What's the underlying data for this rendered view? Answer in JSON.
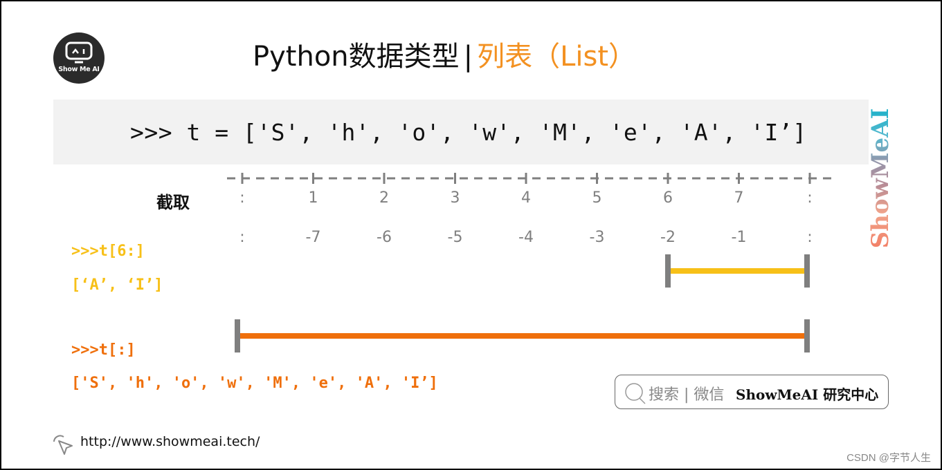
{
  "header": {
    "logo_text": "Show Me AI",
    "title_main": "Python数据类型",
    "title_separator": "|",
    "title_highlight": "列表（List）"
  },
  "code": {
    "definition": ">>> t = ['S', 'h', 'o', 'w', 'M', 'e', 'A', 'I’]"
  },
  "watermark": {
    "text": "ShowMeAI"
  },
  "slicing": {
    "label": "截取",
    "positive_indices": [
      ":",
      "1",
      "2",
      "3",
      "4",
      "5",
      "6",
      "7",
      ":"
    ],
    "negative_indices": [
      ":",
      "-7",
      "-6",
      "-5",
      "-4",
      "-3",
      "-2",
      "-1",
      ":"
    ],
    "examples": [
      {
        "command": ">>>t[6:]",
        "result": "[‘A’, ‘I’]",
        "color": "#f7c018",
        "range_start_index": 6,
        "range_end_index": 8
      },
      {
        "command": ">>>t[:]",
        "result": "['S', 'h', 'o', 'w', 'M', 'e', 'A', 'I’]",
        "color": "#ef6f0b",
        "range_start_index": 0,
        "range_end_index": 8
      }
    ]
  },
  "colors": {
    "title_accent": "#f39121",
    "axis_gray": "#7f7f7f",
    "code_background": "#f2f2f2"
  },
  "footer": {
    "search_label": "搜索 | 微信",
    "search_brand": "ShowMeAI 研究中心",
    "url": "http://www.showmeai.tech/",
    "credit": "CSDN @字节人生"
  }
}
